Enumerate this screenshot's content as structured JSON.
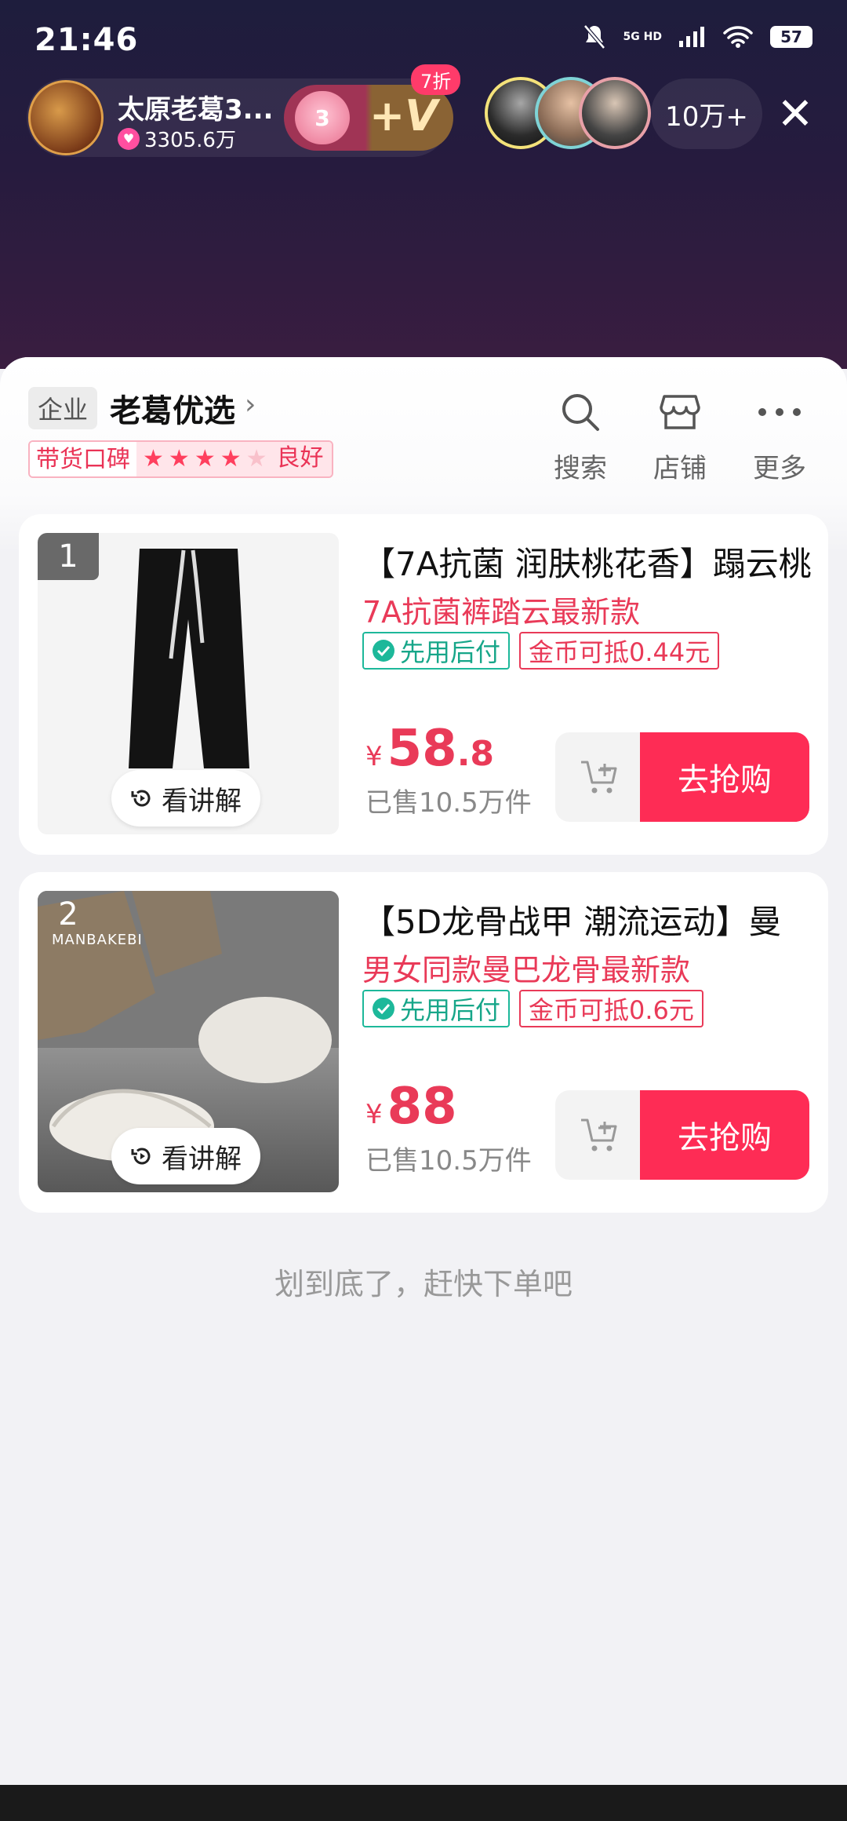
{
  "status_bar": {
    "time": "21:46",
    "network": "5G HD",
    "battery": "57"
  },
  "live": {
    "anchor_name": "太原老葛3...",
    "likes": "3305.6万",
    "fans_level": "3",
    "fans_v": "+V",
    "discount": "7折",
    "viewer_count": "10万+",
    "close": "✕"
  },
  "shop": {
    "tag": "企业",
    "name": "老葛优选",
    "chevron": "›",
    "reputation_label": "带货口碑",
    "reputation_stars": 4,
    "reputation_text": "良好",
    "tools": [
      {
        "label": "搜索",
        "icon": "search-icon"
      },
      {
        "label": "店铺",
        "icon": "store-icon"
      },
      {
        "label": "更多",
        "icon": "more-icon"
      }
    ]
  },
  "products": [
    {
      "rank": "1",
      "title": "【7A抗菌 润肤桃花香】蹋云桃",
      "subtitle": "7A抗菌裤踏云最新款",
      "tag_pay": "先用后付",
      "tag_coin": "金币可抵0.44元",
      "price_symbol": "¥",
      "price_int": "58",
      "price_dec": ".8",
      "sold": "已售10.5万件",
      "explain": "看讲解",
      "buy": "去抢购"
    },
    {
      "rank": "2",
      "title": "【5D龙骨战甲 潮流运动】曼",
      "subtitle": "男女同款曼巴龙骨最新款",
      "tag_pay": "先用后付",
      "tag_coin": "金币可抵0.6元",
      "price_symbol": "¥",
      "price_int": "88",
      "price_dec": "",
      "sold": "已售10.5万件",
      "explain": "看讲解",
      "buy": "去抢购",
      "image_brand": "MANBAKEBI"
    }
  ],
  "footer_text": "划到底了，赶快下单吧",
  "colors": {
    "accent": "#fe2c55",
    "price": "#e93a58",
    "pay_green": "#1db89a"
  }
}
